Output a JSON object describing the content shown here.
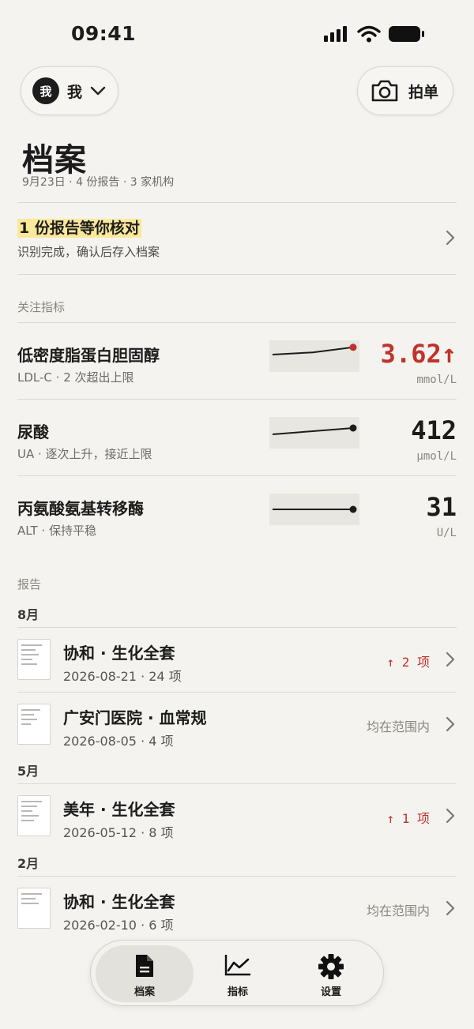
{
  "status_bar": {
    "time": "09:41"
  },
  "header": {
    "profile_avatar": "我",
    "profile_name": "我",
    "camera_label": "拍单"
  },
  "page": {
    "title": "档案",
    "subtitle": "9月23日 · 4 份报告 · 3 家机构"
  },
  "review_banner": {
    "title": "1 份报告等你核对",
    "description": "识别完成，确认后存入档案"
  },
  "metrics_section": {
    "label": "关注指标",
    "items": [
      {
        "name": "低密度脂蛋白胆固醇",
        "sub": "LDL-C · 2 次超出上限",
        "value": "3.62↑",
        "unit": "mmol/L",
        "alert": true,
        "trend": [
          0.55,
          0.62,
          0.78
        ],
        "accent": "#c0322b"
      },
      {
        "name": "尿酸",
        "sub": "UA · 逐次上升，接近上限",
        "value": "412",
        "unit": "μmol/L",
        "alert": false,
        "trend": [
          0.45,
          0.55,
          0.65
        ],
        "accent": "#1c1c1c"
      },
      {
        "name": "丙氨酸氨基转移酶",
        "sub": "ALT · 保持平稳",
        "value": "31",
        "unit": "U/L",
        "alert": false,
        "trend": [
          0.5,
          0.5,
          0.5
        ],
        "accent": "#1c1c1c"
      }
    ]
  },
  "reports_section": {
    "label": "报告",
    "groups": [
      {
        "month": "8月",
        "items": [
          {
            "title": "协和 · 生化全套",
            "meta": "2026-08-21 · 24 项",
            "status": "↑ 2 项",
            "alert": true
          },
          {
            "title": "广安门医院 · 血常规",
            "meta": "2026-08-05 · 4 项",
            "status": "均在范围内",
            "alert": false
          }
        ]
      },
      {
        "month": "5月",
        "items": [
          {
            "title": "美年 · 生化全套",
            "meta": "2026-05-12 · 8 项",
            "status": "↑ 1 项",
            "alert": true
          }
        ]
      },
      {
        "month": "2月",
        "items": [
          {
            "title": "协和 · 生化全套",
            "meta": "2026-02-10 · 6 项",
            "status": "均在范围内",
            "alert": false
          }
        ]
      }
    ]
  },
  "tab_bar": {
    "tabs": [
      {
        "label": "档案",
        "icon": "document-icon",
        "active": true
      },
      {
        "label": "指标",
        "icon": "chart-icon",
        "active": false
      },
      {
        "label": "设置",
        "icon": "gear-icon",
        "active": false
      }
    ]
  },
  "colors": {
    "background": "#f4f3ef",
    "alert": "#c0322b",
    "highlight": "#fbe89a",
    "text": "#1c1c1c"
  }
}
